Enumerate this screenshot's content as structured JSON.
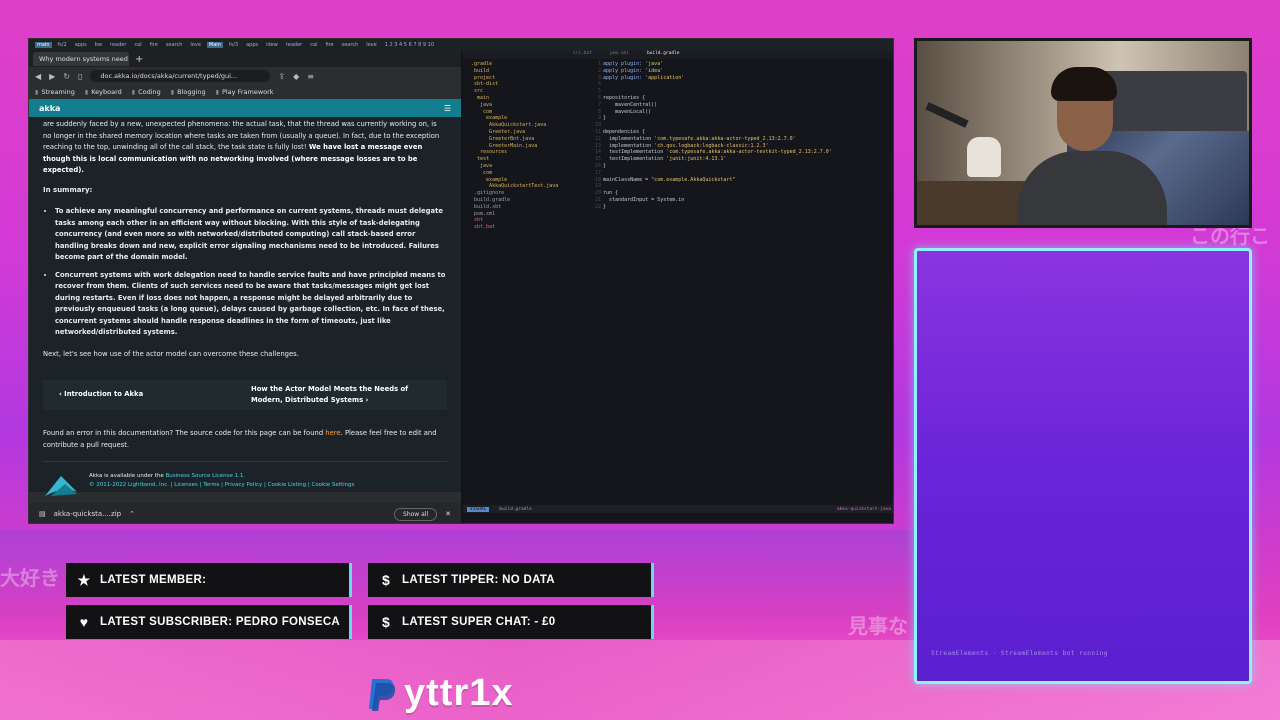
{
  "overlay": {
    "jp_left_1": "大好き",
    "jp_right_1": "この行こ",
    "jp_right_2": "見事な",
    "panel_text": "StreamElements · StreamElements bot running",
    "brand_name": "yttr1x"
  },
  "alerts": [
    {
      "icon": "star-icon",
      "label": "LATEST MEMBER:"
    },
    {
      "icon": "dollar-icon",
      "label": "LATEST TIPPER: NO DATA"
    },
    {
      "icon": "heart-icon",
      "label": "LATEST SUBSCRIBER: PEDRO FONSECA"
    },
    {
      "icon": "dollar-icon",
      "label": "LATEST SUPER CHAT: - £0"
    }
  ],
  "browser": {
    "tab_title": "Why modern systems need",
    "url": "doc.akka.io/docs/akka/current/typed/gui...",
    "bookmarks": [
      "Streaming",
      "Keyboard",
      "Coding",
      "Blogging",
      "Play Framework"
    ],
    "site_name": "akka",
    "download_file": "akka-quicksta....zip",
    "show_all": "Show all"
  },
  "doc": {
    "para1_a": "are suddenly faced by a new, unexpected phenomena: the actual task, that the thread was currently working on, is no longer in the shared memory location where tasks are taken from (usually a queue). In fact, due to the exception reaching to the top, unwinding all of the call stack, the task state is fully lost!",
    "para1_b": " We have lost a message even though this is local communication with no networking involved (where message losses are to be expected).",
    "summary_heading": "In summary:",
    "bullets": [
      "To achieve any meaningful concurrency and performance on current systems, threads must delegate tasks among each other in an efficient way without blocking. With this style of task-delegating concurrency (and even more so with networked/distributed computing) call stack-based error handling breaks down and new, explicit error signaling mechanisms need to be introduced. Failures become part of the domain model.",
      "Concurrent systems with work delegation need to handle service faults and have principled means to recover from them. Clients of such services need to be aware that tasks/messages might get lost during restarts. Even if loss does not happen, a response might be delayed arbitrarily due to previously enqueued tasks (a long queue), delays caused by garbage collection, etc. In face of these, concurrent systems should handle response deadlines in the form of timeouts, just like networked/distributed systems."
    ],
    "next_para": "Next, let's see how use of the actor model can overcome these challenges.",
    "prev_link": "Introduction to Akka",
    "next_link": "How the Actor Model Meets the Needs of Modern, Distributed Systems",
    "found_a": "Found an error in this documentation? The source code for this page can be found ",
    "found_link": "here",
    "found_b": ". Please feel free to edit and contribute a pull request.",
    "footer_1a": "Akka is available under the ",
    "footer_1b": "Business Source License 1.1.",
    "footer_2": "© 2011-2022 Lightbend, Inc. | Licenses | Terms | Privacy Policy | Cookie Listing | Cookie Settings"
  },
  "editor": {
    "tab_active": "build.gradle",
    "mode": "VISUAL",
    "status_file": "build.gradle",
    "status_right": "akka-quickstart-java"
  },
  "colors": {
    "panel_border": "#8ef3ff",
    "akka_teal": "#127d8e",
    "link_orange": "#ff9d2e"
  }
}
